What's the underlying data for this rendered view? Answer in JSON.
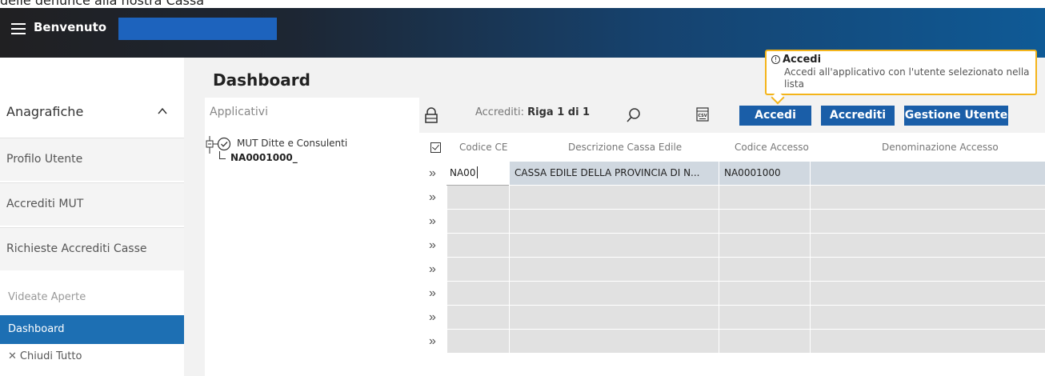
{
  "caption": "delle denunce alla nostra Cassa",
  "header": {
    "welcome": "Benvenuto"
  },
  "sidebar": {
    "section_title": "Anagrafiche",
    "items": [
      {
        "label": "Profilo Utente"
      },
      {
        "label": "Accrediti MUT"
      },
      {
        "label": "Richieste Accrediti Casse"
      }
    ],
    "open_views_label": "Videate Aperte",
    "active_view": "Dashboard",
    "close_all": "Chiudi Tutto"
  },
  "main": {
    "title": "Dashboard",
    "apps_label": "Applicativi",
    "tree": {
      "root": "MUT Ditte e Consulenti",
      "child": "NA0001000_"
    }
  },
  "toolbar": {
    "accrediti_prefix": "Accrediti:",
    "accrediti_count": "Riga 1 di 1",
    "accedi": "Accedi",
    "accrediti": "Accrediti",
    "gestione_utente": "Gestione Utente"
  },
  "tooltip": {
    "title": "Accedi",
    "body": "Accedi all'applicativo con l'utente selezionato nella lista"
  },
  "grid": {
    "columns": [
      "Codice CE",
      "Descrizione Cassa Edile",
      "Codice Accesso",
      "Denominazione Accesso"
    ],
    "rows": [
      {
        "codice_ce": "NA00",
        "descrizione": "CASSA EDILE DELLA PROVINCIA DI N...",
        "codice_accesso": "NA0001000",
        "denominazione": ""
      },
      {
        "codice_ce": "",
        "descrizione": "",
        "codice_accesso": "",
        "denominazione": ""
      },
      {
        "codice_ce": "",
        "descrizione": "",
        "codice_accesso": "",
        "denominazione": ""
      },
      {
        "codice_ce": "",
        "descrizione": "",
        "codice_accesso": "",
        "denominazione": ""
      },
      {
        "codice_ce": "",
        "descrizione": "",
        "codice_accesso": "",
        "denominazione": ""
      },
      {
        "codice_ce": "",
        "descrizione": "",
        "codice_accesso": "",
        "denominazione": ""
      },
      {
        "codice_ce": "",
        "descrizione": "",
        "codice_accesso": "",
        "denominazione": ""
      },
      {
        "codice_ce": "",
        "descrizione": "",
        "codice_accesso": "",
        "denominazione": ""
      }
    ],
    "expand_glyph": "»"
  },
  "colors": {
    "primary": "#1a5ea8",
    "active": "#1d6fb3",
    "tooltip_border": "#f4b41a",
    "header_dark": "#202022",
    "header_blue": "#0f5a96"
  }
}
